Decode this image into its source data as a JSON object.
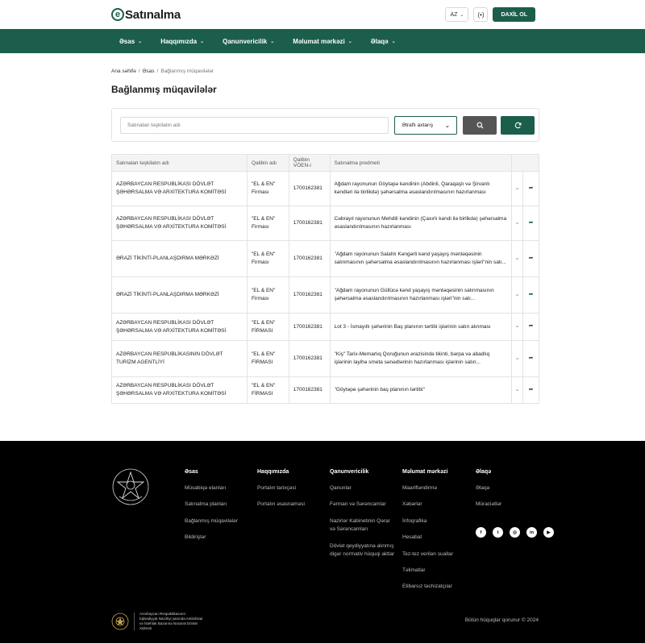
{
  "header": {
    "logo_letter": "e",
    "logo_text": "Satınalma",
    "lang": "AZ",
    "a11y_label": "(•)",
    "login_label": "DAXİL OL"
  },
  "nav": [
    {
      "label": "Əsas"
    },
    {
      "label": "Haqqımızda"
    },
    {
      "label": "Qanunvericilik"
    },
    {
      "label": "Məlumat mərkəzi"
    },
    {
      "label": "Əlaqə"
    }
  ],
  "breadcrumb": {
    "home": "Ana səhifə",
    "section": "Əsas",
    "current": "Bağlanmış müqavilələr",
    "sep": "/"
  },
  "page_title": "Bağlanmış müqavilələr",
  "search": {
    "placeholder": "Satınalan təşkilatın adı",
    "advanced_label": "Ətraflı axtarış"
  },
  "table": {
    "headers": [
      "Satınalan təşkilatın adı",
      "Qalibin adı",
      "Qalibin VÖEN-i",
      "Satınalma predmeti"
    ],
    "rows": [
      {
        "org": "AZƏRBAYCAN RESPUBLİKASI DÖVLƏT ŞƏHƏRSALMA VƏ ARXİTEKTURA KOMİTƏSİ",
        "winner": "\"EL & EN\" Firması",
        "voen": "1700162381",
        "subject": "Ağdam rayonunun Göytəpə kəndinin (Abdinli, Qaraqaşlı və Şirvanlı kəndləri ilə birlikdə) şəhərsalma əsaslandırılmasının hazırlanması"
      },
      {
        "org": "AZƏRBAYCAN RESPUBLİKASI DÖVLƏT ŞƏHƏRSALMA VƏ ARXİTEKTURA KOMİTƏSİ",
        "winner": "\"EL & EN\" Firması",
        "voen": "1700162381",
        "subject": "Cəbrayıl rayonunun Mehdili kəndinin (Çaxırlı kəndi ilə birlikdə) şəhərsalma əsaslandırılmasının hazırlanması"
      },
      {
        "org": "ƏRAZİ TİKİNTİ-PLANLAŞDIRMA MƏRKƏZİ",
        "winner": "\"EL & EN\" Firması",
        "voen": "1700162381",
        "subject": "\"Ağdam rayonunun Salahlı Kəngərli kənd yaşayış məntəqəsinin salınmasının şəhərsalma əsaslandırılmasının hazırlanması işləri\"nin satı..."
      },
      {
        "org": "ƏRAZİ TİKİNTİ-PLANLAŞDIRMA MƏRKƏZİ",
        "winner": "\"EL & EN\" Firması",
        "voen": "1700162381",
        "subject": "\"Ağdam rayonunun Güllücə kənd yaşayış məntəqəsinin salınmasının şəhərsalma əsaslandırılmasının hazırlanması işləri\"nin satı..."
      },
      {
        "org": "AZƏRBAYCAN RESPUBLİKASI DÖVLƏT ŞƏHƏRSALMA VƏ ARXİTEKTURA KOMİTƏSİ",
        "winner": "\"EL & EN\" FİRMASI",
        "voen": "1700162381",
        "subject": "Lot 3 - İsmayıllı şəhərinin Baş planının tərtibi işlərinin satın alınması"
      },
      {
        "org": "AZƏRBAYCAN RESPUBLİKASININ DÖVLƏT TURİZM AGENTLİYİ",
        "winner": "\"EL & EN\" FİRMASI",
        "voen": "1700162381",
        "subject": "\"Kiş\" Tarix-Memarlıq Qoruğunun ərazisində tikinti, bərpa və abadlıq işlərinin layihə smeta sənədlərinin hazırlanması işlərinin satın..."
      },
      {
        "org": "AZƏRBAYCAN RESPUBLİKASI DÖVLƏT ŞƏHƏRSALMA VƏ ARXİTEKTURA KOMİTƏSİ",
        "winner": "\"EL & EN\" FİRMASI",
        "voen": "1700162381",
        "subject": "\"Göytəpə şəhərinin baş planının tərtibi\""
      }
    ]
  },
  "footer": {
    "columns": [
      {
        "title": "Əsas",
        "links": [
          "Müsabiqə elanları",
          "Satınalma planları",
          "Bağlanmış müqavilələr",
          "Bildirişlər"
        ]
      },
      {
        "title": "Haqqımızda",
        "links": [
          "Portalın tarixçəsi",
          "Portalın əsasnaməsi"
        ]
      },
      {
        "title": "Qanunvericilik",
        "links": [
          "Qanunlar",
          "Fərman və Sərəncamlar",
          "Nazirlər Kabinetinin Qərar və Sərəncamları",
          "Dövlət qeydiyyatına alınmış digər normativ hüquqi aktlar"
        ]
      },
      {
        "title": "Məlumat mərkəzi",
        "links": [
          "Maarifləndirmə",
          "Xəbərlər",
          "İnfoqrafika",
          "Hesabat",
          "Tez-tez verilən suallar",
          "Təlimatlar",
          "Etibarsız təchizatçılar"
        ]
      },
      {
        "title": "Əlaqə",
        "links": [
          "Əlaqə",
          "Müraciətlər"
        ]
      }
    ],
    "socials": [
      {
        "name": "facebook-icon",
        "glyph": "f"
      },
      {
        "name": "twitter-icon",
        "glyph": "t"
      },
      {
        "name": "instagram-icon",
        "glyph": "◎"
      },
      {
        "name": "linkedin-icon",
        "glyph": "in"
      },
      {
        "name": "youtube-icon",
        "glyph": "▶"
      }
    ],
    "agency_text": "Azərbaycan Respublikasının İqtisadiyyat Nazirliyi yanında Antiinhisar və İstehlak Bazarına Nəzarət Dövlət Xidməti",
    "copyright": "Bütün hüquqlar qorunur © 2024"
  },
  "colors": {
    "brand": "#1b5e4b",
    "search_btn": "#555555",
    "footer_bg": "#000000"
  }
}
